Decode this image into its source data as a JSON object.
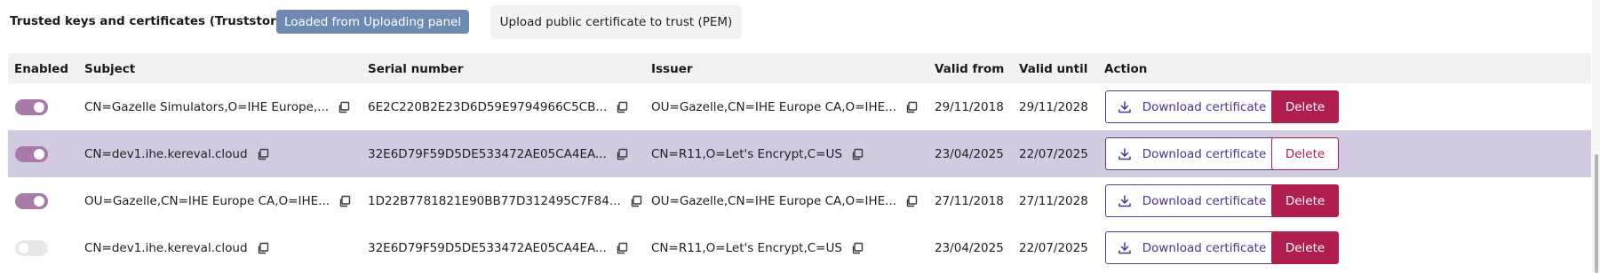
{
  "header": {
    "title": "Trusted keys and certificates (Truststore)",
    "source_pill": "Loaded from Uploading panel",
    "upload_button": "Upload public certificate to trust (PEM)"
  },
  "columns": {
    "enabled": "Enabled",
    "subject": "Subject",
    "serial": "Serial number",
    "issuer": "Issuer",
    "valid_from": "Valid from",
    "valid_until": "Valid until",
    "action": "Action"
  },
  "rows": [
    {
      "enabled": true,
      "subject": "CN=Gazelle Simulators,O=IHE Europe,...",
      "serial": "6E2C220B2E23D6D59E9794966C5CB...",
      "issuer": "OU=Gazelle,CN=IHE Europe CA,O=IHE...",
      "valid_from": "29/11/2018",
      "valid_until": "29/11/2028",
      "download_label": "Download certificate",
      "delete_label": "Delete",
      "selected": false
    },
    {
      "enabled": true,
      "subject": "CN=dev1.ihe.kereval.cloud",
      "serial": "32E6D79F59D5DE533472AE05CA4EA...",
      "issuer": "CN=R11,O=Let's Encrypt,C=US",
      "valid_from": "23/04/2025",
      "valid_until": "22/07/2025",
      "download_label": "Download certificate",
      "delete_label": "Delete",
      "selected": true
    },
    {
      "enabled": true,
      "subject": "OU=Gazelle,CN=IHE Europe CA,O=IHE...",
      "serial": "1D22B7781821E90BB77D312495C7F84...",
      "issuer": "OU=Gazelle,CN=IHE Europe CA,O=IHE...",
      "valid_from": "27/11/2018",
      "valid_until": "27/11/2028",
      "download_label": "Download certificate",
      "delete_label": "Delete",
      "selected": false
    },
    {
      "enabled": false,
      "subject": "CN=dev1.ihe.kereval.cloud",
      "serial": "32E6D79F59D5DE533472AE05CA4EA...",
      "issuer": "CN=R11,O=Let's Encrypt,C=US",
      "valid_from": "23/04/2025",
      "valid_until": "22/07/2025",
      "download_label": "Download certificate",
      "delete_label": "Delete",
      "selected": false
    }
  ],
  "icons": {
    "copy": "copy-icon",
    "download": "download-icon"
  },
  "colors": {
    "accent": "#4f3190",
    "toggle_on": "#a87aa8",
    "delete": "#b01e4e",
    "selected_row": "#d2cae0",
    "pill": "#7089b3"
  }
}
